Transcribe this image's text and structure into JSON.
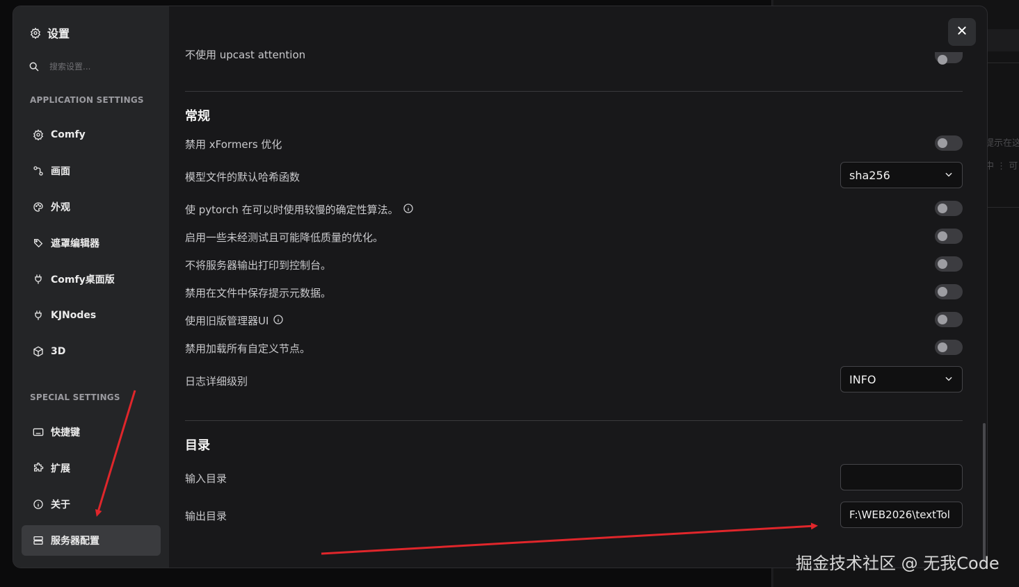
{
  "background": {
    "right_text_1": "提示在这",
    "right_text_2": "中 ⋮ 可"
  },
  "sidebar": {
    "title": "设置",
    "search_placeholder": "搜索设置...",
    "app_section_label": "APPLICATION SETTINGS",
    "app_items": [
      {
        "label": "Comfy",
        "icon": "gear-icon"
      },
      {
        "label": "画面",
        "icon": "nodes-icon"
      },
      {
        "label": "外观",
        "icon": "palette-icon"
      },
      {
        "label": "遮罩编辑器",
        "icon": "brush-icon"
      },
      {
        "label": "Comfy桌面版",
        "icon": "plug-icon"
      },
      {
        "label": "KJNodes",
        "icon": "plug-icon"
      },
      {
        "label": "3D",
        "icon": "cube-icon"
      }
    ],
    "special_section_label": "SPECIAL SETTINGS",
    "special_items": [
      {
        "label": "快捷键",
        "icon": "keyboard-icon"
      },
      {
        "label": "扩展",
        "icon": "puzzle-icon"
      },
      {
        "label": "关于",
        "icon": "info-icon"
      },
      {
        "label": "服务器配置",
        "icon": "server-icon",
        "active": true
      }
    ]
  },
  "content": {
    "cut_off_row": "不使用 upcast attention",
    "general": {
      "heading": "常规",
      "rows": [
        {
          "label": "禁用 xFormers 优化",
          "control": "toggle",
          "on": false
        },
        {
          "label": "模型文件的默认哈希函数",
          "control": "select",
          "value": "sha256"
        },
        {
          "label": "使 pytorch 在可以时使用较慢的确定性算法。",
          "control": "toggle",
          "on": false,
          "info": true
        },
        {
          "label": "启用一些未经测试且可能降低质量的优化。",
          "control": "toggle",
          "on": false
        },
        {
          "label": "不将服务器输出打印到控制台。",
          "control": "toggle",
          "on": false
        },
        {
          "label": "禁用在文件中保存提示元数据。",
          "control": "toggle",
          "on": false
        },
        {
          "label": "使用旧版管理器UI",
          "control": "toggle",
          "on": false,
          "info": true
        },
        {
          "label": "禁用加载所有自定义节点。",
          "control": "toggle",
          "on": false
        },
        {
          "label": "日志详细级别",
          "control": "select",
          "value": "INFO"
        }
      ]
    },
    "directories": {
      "heading": "目录",
      "input_label": "输入目录",
      "input_value": "",
      "output_label": "输出目录",
      "output_value": "F:\\WEB2026\\textTol"
    }
  },
  "watermark": "掘金技术社区 @ 无我Code",
  "annotation_color": "#e0262b"
}
